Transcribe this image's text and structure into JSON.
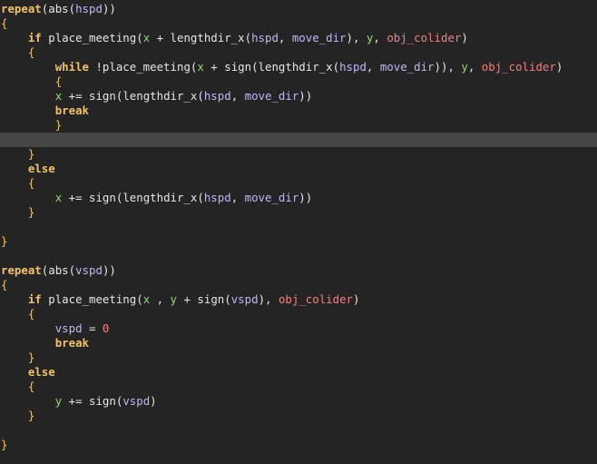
{
  "editor": {
    "current_line_index": 9,
    "colors": {
      "background": "#242424",
      "current_line": "#464646",
      "keyword": "#f4c267",
      "variable": "#bcb9f5",
      "builtin_var": "#8fdc6b",
      "object": "#f2817f",
      "number": "#f2817f",
      "text": "#e6e6e6"
    },
    "lines": [
      [
        {
          "t": "repeat",
          "c": "kw"
        },
        {
          "t": "(",
          "c": "txt"
        },
        {
          "t": "abs",
          "c": "fn"
        },
        {
          "t": "(",
          "c": "txt"
        },
        {
          "t": "hspd",
          "c": "var"
        },
        {
          "t": "))",
          "c": "txt"
        }
      ],
      [
        {
          "t": "{",
          "c": "brace"
        }
      ],
      [
        {
          "t": "    ",
          "c": "txt"
        },
        {
          "t": "if",
          "c": "kw"
        },
        {
          "t": " ",
          "c": "txt"
        },
        {
          "t": "place_meeting",
          "c": "fn"
        },
        {
          "t": "(",
          "c": "txt"
        },
        {
          "t": "x",
          "c": "bi"
        },
        {
          "t": " + ",
          "c": "op"
        },
        {
          "t": "lengthdir_x",
          "c": "fn"
        },
        {
          "t": "(",
          "c": "txt"
        },
        {
          "t": "hspd",
          "c": "var"
        },
        {
          "t": ", ",
          "c": "txt"
        },
        {
          "t": "move_dir",
          "c": "var"
        },
        {
          "t": "), ",
          "c": "txt"
        },
        {
          "t": "y",
          "c": "bi"
        },
        {
          "t": ", ",
          "c": "txt"
        },
        {
          "t": "obj_colider",
          "c": "obj"
        },
        {
          "t": ")",
          "c": "txt"
        }
      ],
      [
        {
          "t": "    ",
          "c": "txt"
        },
        {
          "t": "{",
          "c": "brace"
        }
      ],
      [
        {
          "t": "        ",
          "c": "txt"
        },
        {
          "t": "while",
          "c": "kw"
        },
        {
          "t": " !",
          "c": "op"
        },
        {
          "t": "place_meeting",
          "c": "fn"
        },
        {
          "t": "(",
          "c": "txt"
        },
        {
          "t": "x",
          "c": "bi"
        },
        {
          "t": " + ",
          "c": "op"
        },
        {
          "t": "sign",
          "c": "fn"
        },
        {
          "t": "(",
          "c": "txt"
        },
        {
          "t": "lengthdir_x",
          "c": "fn"
        },
        {
          "t": "(",
          "c": "txt"
        },
        {
          "t": "hspd",
          "c": "var"
        },
        {
          "t": ", ",
          "c": "txt"
        },
        {
          "t": "move_dir",
          "c": "var"
        },
        {
          "t": ")), ",
          "c": "txt"
        },
        {
          "t": "y",
          "c": "bi"
        },
        {
          "t": ", ",
          "c": "txt"
        },
        {
          "t": "obj_colider",
          "c": "obj"
        },
        {
          "t": ")",
          "c": "txt"
        }
      ],
      [
        {
          "t": "        ",
          "c": "txt"
        },
        {
          "t": "{",
          "c": "brace"
        }
      ],
      [
        {
          "t": "        ",
          "c": "txt"
        },
        {
          "t": "x",
          "c": "bi"
        },
        {
          "t": " += ",
          "c": "op"
        },
        {
          "t": "sign",
          "c": "fn"
        },
        {
          "t": "(",
          "c": "txt"
        },
        {
          "t": "lengthdir_x",
          "c": "fn"
        },
        {
          "t": "(",
          "c": "txt"
        },
        {
          "t": "hspd",
          "c": "var"
        },
        {
          "t": ", ",
          "c": "txt"
        },
        {
          "t": "move_dir",
          "c": "var"
        },
        {
          "t": "))",
          "c": "txt"
        }
      ],
      [
        {
          "t": "        ",
          "c": "txt"
        },
        {
          "t": "break",
          "c": "kw"
        }
      ],
      [
        {
          "t": "        ",
          "c": "txt"
        },
        {
          "t": "}",
          "c": "brace"
        }
      ],
      [],
      [
        {
          "t": "    ",
          "c": "txt"
        },
        {
          "t": "}",
          "c": "brace"
        }
      ],
      [
        {
          "t": "    ",
          "c": "txt"
        },
        {
          "t": "else",
          "c": "kw"
        }
      ],
      [
        {
          "t": "    ",
          "c": "txt"
        },
        {
          "t": "{",
          "c": "brace"
        }
      ],
      [
        {
          "t": "        ",
          "c": "txt"
        },
        {
          "t": "x",
          "c": "bi"
        },
        {
          "t": " += ",
          "c": "op"
        },
        {
          "t": "sign",
          "c": "fn"
        },
        {
          "t": "(",
          "c": "txt"
        },
        {
          "t": "lengthdir_x",
          "c": "fn"
        },
        {
          "t": "(",
          "c": "txt"
        },
        {
          "t": "hspd",
          "c": "var"
        },
        {
          "t": ", ",
          "c": "txt"
        },
        {
          "t": "move_dir",
          "c": "var"
        },
        {
          "t": "))",
          "c": "txt"
        }
      ],
      [
        {
          "t": "    ",
          "c": "txt"
        },
        {
          "t": "}",
          "c": "brace"
        }
      ],
      [],
      [
        {
          "t": "}",
          "c": "brace"
        }
      ],
      [],
      [
        {
          "t": "repeat",
          "c": "kw"
        },
        {
          "t": "(",
          "c": "txt"
        },
        {
          "t": "abs",
          "c": "fn"
        },
        {
          "t": "(",
          "c": "txt"
        },
        {
          "t": "vspd",
          "c": "var"
        },
        {
          "t": "))",
          "c": "txt"
        }
      ],
      [
        {
          "t": "{",
          "c": "brace"
        }
      ],
      [
        {
          "t": "    ",
          "c": "txt"
        },
        {
          "t": "if",
          "c": "kw"
        },
        {
          "t": " ",
          "c": "txt"
        },
        {
          "t": "place_meeting",
          "c": "fn"
        },
        {
          "t": "(",
          "c": "txt"
        },
        {
          "t": "x",
          "c": "bi"
        },
        {
          "t": " , ",
          "c": "txt"
        },
        {
          "t": "y",
          "c": "bi"
        },
        {
          "t": " + ",
          "c": "op"
        },
        {
          "t": "sign",
          "c": "fn"
        },
        {
          "t": "(",
          "c": "txt"
        },
        {
          "t": "vspd",
          "c": "var"
        },
        {
          "t": "), ",
          "c": "txt"
        },
        {
          "t": "obj_colider",
          "c": "obj"
        },
        {
          "t": ")",
          "c": "txt"
        }
      ],
      [
        {
          "t": "    ",
          "c": "txt"
        },
        {
          "t": "{",
          "c": "brace"
        }
      ],
      [
        {
          "t": "        ",
          "c": "txt"
        },
        {
          "t": "vspd",
          "c": "var"
        },
        {
          "t": " = ",
          "c": "op"
        },
        {
          "t": "0",
          "c": "num"
        }
      ],
      [
        {
          "t": "        ",
          "c": "txt"
        },
        {
          "t": "break",
          "c": "kw"
        }
      ],
      [
        {
          "t": "    ",
          "c": "txt"
        },
        {
          "t": "}",
          "c": "brace"
        }
      ],
      [
        {
          "t": "    ",
          "c": "txt"
        },
        {
          "t": "else",
          "c": "kw"
        }
      ],
      [
        {
          "t": "    ",
          "c": "txt"
        },
        {
          "t": "{",
          "c": "brace"
        }
      ],
      [
        {
          "t": "        ",
          "c": "txt"
        },
        {
          "t": "y",
          "c": "bi"
        },
        {
          "t": " += ",
          "c": "op"
        },
        {
          "t": "sign",
          "c": "fn"
        },
        {
          "t": "(",
          "c": "txt"
        },
        {
          "t": "vspd",
          "c": "var"
        },
        {
          "t": ")",
          "c": "txt"
        }
      ],
      [
        {
          "t": "    ",
          "c": "txt"
        },
        {
          "t": "}",
          "c": "brace"
        }
      ],
      [],
      [
        {
          "t": "}",
          "c": "brace"
        }
      ]
    ]
  }
}
